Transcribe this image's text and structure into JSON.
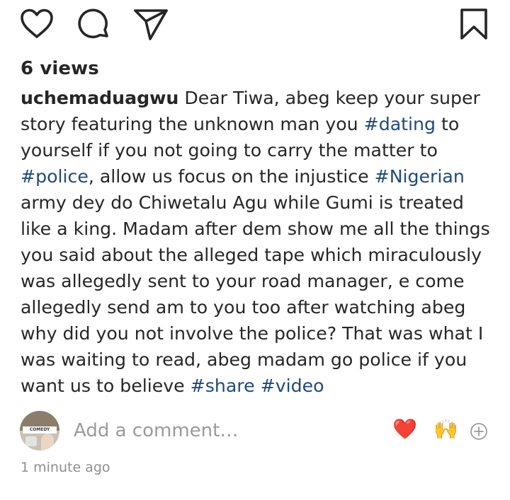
{
  "stats": {
    "views": "6 views"
  },
  "caption": {
    "username": "uchemaduagwu",
    "parts": [
      " Dear Tiwa, abeg keep your super story featuring the unknown man you ",
      "#dating",
      " to yourself if you not going to carry the matter to ",
      "#police",
      ", allow us focus on the injustice ",
      "#Nigerian",
      " army dey do Chiwetalu Agu while Gumi is treated like a king. Madam after dem show me all the things you said about the alleged tape which miraculously was allegedly sent to your road manager, e come allegedly send am to you too after watching abeg why did you not involve the police? That was what I was waiting to read, abeg madam go police if you want us to believe ",
      "#share",
      " ",
      "#video"
    ]
  },
  "comment_bar": {
    "placeholder": "Add a comment…",
    "quick_reactions": [
      "❤️",
      "🙌"
    ],
    "avatar_caption": "COMEDY"
  },
  "timestamp": "1 minute ago",
  "icons": {
    "like": "heart-outline-icon",
    "comment": "comment-bubble-icon",
    "share": "paper-plane-icon",
    "save": "bookmark-icon",
    "more_emoji": "add-circle-icon"
  },
  "colors": {
    "text": "#262626",
    "hashtag": "#1e4a7a",
    "muted": "#8e8e8e",
    "heart": "#d8192b"
  }
}
